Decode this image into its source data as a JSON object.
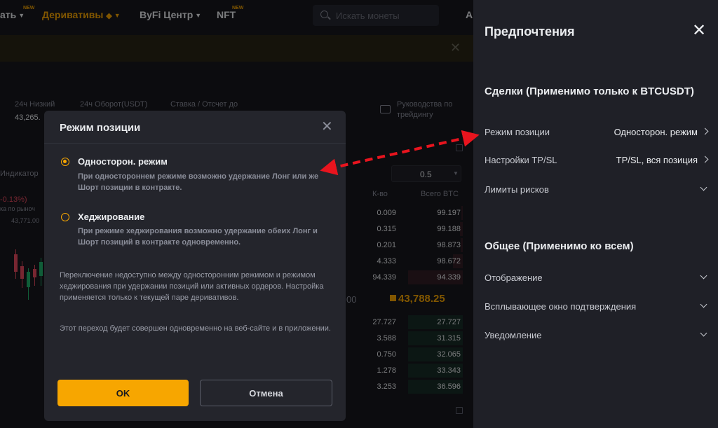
{
  "nav": {
    "item1": "ать",
    "item1_badge": "NEW",
    "derivatives": "Деривативы",
    "byfi": "ByFi Центр",
    "nft": "NFT",
    "nft_badge": "NEW",
    "search_placeholder": "Искать монеты",
    "edge": "A"
  },
  "stats": {
    "low_label": "24ч Низкий",
    "low_value": "43,265.",
    "turnover_label": "24ч Оборот(USDT)",
    "funding_label": "Ставка / Отсчет до",
    "guide": "Руководства по трейдингу"
  },
  "chart_side": {
    "indicator": "Индикатор",
    "change": "-0.13%)",
    "market": "ка по рыноч",
    "price": "43,771.00"
  },
  "orderbook": {
    "step": "0.5",
    "qty_header": "К-во",
    "total_header": "Всего BTC",
    "asks": [
      {
        "qty": "0.009",
        "total": "99.197"
      },
      {
        "qty": "0.315",
        "total": "99.188"
      },
      {
        "qty": "0.201",
        "total": "98.873"
      },
      {
        "qty": "4.333",
        "total": "98.672"
      },
      {
        "qty": "94.339",
        "total": "94.339"
      }
    ],
    "left_partial": "00",
    "last_price": "43,788.25",
    "bids": [
      {
        "qty": "27.727",
        "total": "27.727"
      },
      {
        "qty": "3.588",
        "total": "31.315"
      },
      {
        "qty": "0.750",
        "total": "32.065"
      },
      {
        "qty": "1.278",
        "total": "33.343"
      },
      {
        "qty": "3.253",
        "total": "36.596"
      }
    ]
  },
  "modal": {
    "title": "Режим позиции",
    "option1_title": "Односторон. режим",
    "option1_desc": "При одностороннем режиме возможно удержание Лонг или же Шорт позиции в контракте.",
    "option2_title": "Хеджирование",
    "option2_desc": "При режиме хеджирования возможно удержание обеих Лонг и Шорт позиций в контракте одновременно.",
    "note1": "Переключение недоступно между односторонним режимом и режимом хеджирования при удержании позиций или активных ордеров. Настройка применяется только к текущей паре деривативов.",
    "note2": "Этот переход будет совершен одновременно на веб-сайте и в приложении.",
    "ok": "OK",
    "cancel": "Отмена"
  },
  "panel": {
    "title": "Предпочтения",
    "trades_section": "Сделки (Применимо только к BTCUSDT)",
    "position_mode_label": "Режим позиции",
    "position_mode_value": "Односторон. режим",
    "tpsl_label": "Настройки TP/SL",
    "tpsl_value": "TP/SL, вся позиция",
    "risk_label": "Лимиты рисков",
    "general_section": "Общее (Применимо ко всем)",
    "display_label": "Отображение",
    "confirm_label": "Всплывающее окно подтверждения",
    "notify_label": "Уведомление"
  },
  "colors": {
    "accent": "#f7a600",
    "annotation": "#e8141e",
    "sell": "#e64a5f",
    "buy": "#20b26c"
  }
}
